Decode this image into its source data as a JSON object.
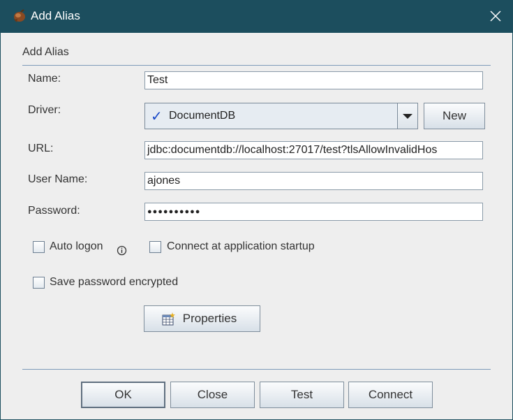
{
  "window": {
    "title": "Add Alias"
  },
  "group": {
    "title": "Add Alias"
  },
  "form": {
    "name_label": "Name:",
    "name_value": "Test",
    "driver_label": "Driver:",
    "driver_value": "DocumentDB",
    "new_button": "New",
    "url_label": "URL:",
    "url_value": "jdbc:documentdb://localhost:27017/test?tlsAllowInvalidHos",
    "username_label": "User Name:",
    "username_value": "ajones",
    "password_label": "Password:",
    "password_value": "●●●●●●●●●●"
  },
  "options": {
    "auto_logon": "Auto logon",
    "connect_startup": "Connect at application startup",
    "save_encrypted": "Save password encrypted"
  },
  "properties_button": "Properties",
  "footer": {
    "ok": "OK",
    "close": "Close",
    "test": "Test",
    "connect": "Connect"
  }
}
